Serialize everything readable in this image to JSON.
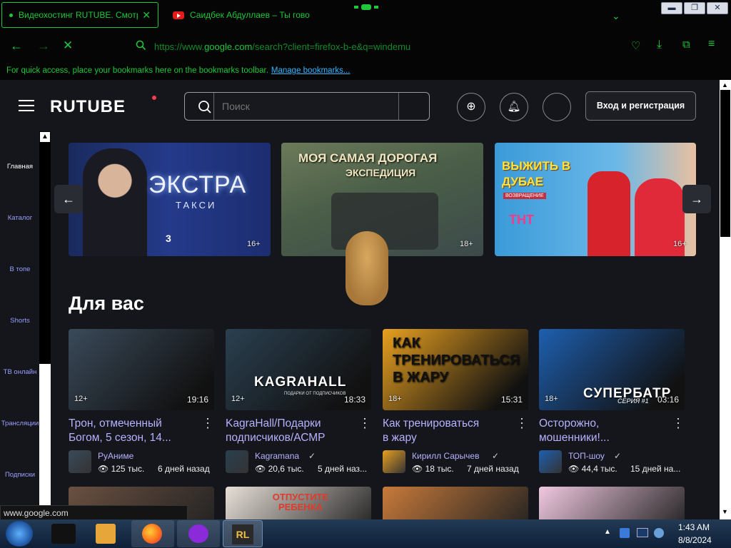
{
  "browser": {
    "tab1": "Видеохостинг RUTUBE. Смотр",
    "tab2": "Саидбек Абдуллаев – Ты гово",
    "url_prefix": "https://www.",
    "url_host": "google.com",
    "url_rest": "/search?client=firefox-b-e&q=windemu",
    "bookmarks_text": "For quick access, place your bookmarks here on the bookmarks toolbar.",
    "bookmarks_link": "Manage bookmarks...",
    "status_url": "www.google.com"
  },
  "header": {
    "logo": "RUTUBE",
    "search_placeholder": "Поиск",
    "login": "Вход и регистрация"
  },
  "sidebar": [
    "Главная",
    "Каталог",
    "В топе",
    "Shorts",
    "ТВ онлайн",
    "Трансляции",
    "Подписки"
  ],
  "banners": [
    {
      "title": "ЭКСТРА",
      "subtitle": "ТАКСИ",
      "number": "3",
      "age": "16+"
    },
    {
      "title": "МОЯ САМАЯ ДОРОГАЯ",
      "subtitle": "ЭКСПЕДИЦИЯ",
      "age": "18+"
    },
    {
      "title": "ВЫЖИТЬ В ДУБАЕ",
      "subtitle": "ВОЗВРАЩЕНИЕ",
      "tag": "ТНТ",
      "age": "16+"
    }
  ],
  "section_title": "Для вас",
  "videos": [
    {
      "line1": "Трон, отмеченный",
      "line2": "Богом, 5 сезон, 14...",
      "age": "12+",
      "duration": "19:16",
      "channel": "РуАниме",
      "views": "125 тыс.",
      "date": "6 дней назад",
      "color": "#3a4a5a"
    },
    {
      "line1": "KagraHall/Подарки",
      "line2": "подписчиков/АСМР",
      "age": "12+",
      "duration": "18:33",
      "channel": "Kagramana",
      "views": "20,6 тыс.",
      "date": "5 дней наз...",
      "overlay": "KAGRAHALL",
      "sub": "ПОДАРКИ ОТ ПОДПИСЧИКОВ",
      "color": "#2a4050"
    },
    {
      "line1": "Как тренироваться",
      "line2": "в жару",
      "age": "18+",
      "duration": "15:31",
      "channel": "Кирилл Сарычев",
      "views": "18 тыс.",
      "date": "7 дней назад",
      "overlay": "КАК ТРЕНИРОВАТЬСЯ В ЖАРУ",
      "color": "#e8a020"
    },
    {
      "line1": "Осторожно,",
      "line2": "мошенники!...",
      "age": "18+",
      "duration": "03:16",
      "channel": "ТОП-шоу",
      "views": "44,4 тыс.",
      "date": "15 дней на...",
      "overlay": "СУПЕРБАТР",
      "series": "СЕРИЯ #1",
      "color": "#1e5fb0"
    }
  ],
  "row2_overlay": "ОТПУСТИТЕ РЕБЕНКА",
  "taskbar": {
    "time": "1:43 AM",
    "date": "8/8/2024"
  }
}
